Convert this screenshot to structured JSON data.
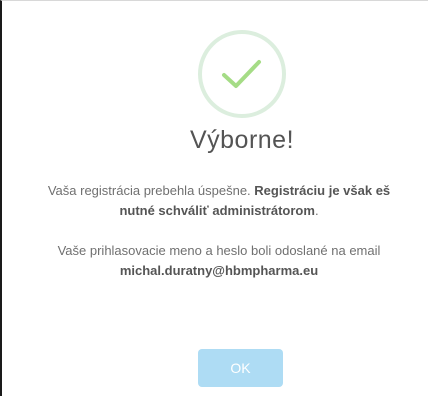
{
  "dialog": {
    "icon": "checkmark-icon",
    "title": "Výborne!",
    "message1_normal": "Vaša registrácia prebehla úspešne. ",
    "message1_bold_a": "Registráciu je však eš",
    "message1_bold_b": "nutné schváliť administrátorom",
    "message1_end": ".",
    "message2_line1": "Vaše prihlasovacie meno a heslo boli odoslané na email",
    "message2_email": "michal.duratny@hbmpharma.eu",
    "ok_label": "OK"
  },
  "colors": {
    "success_ring": "#dceede",
    "success_check": "#a5dc86",
    "button_bg": "#aedcf4",
    "title": "#545454",
    "text": "#707070"
  }
}
